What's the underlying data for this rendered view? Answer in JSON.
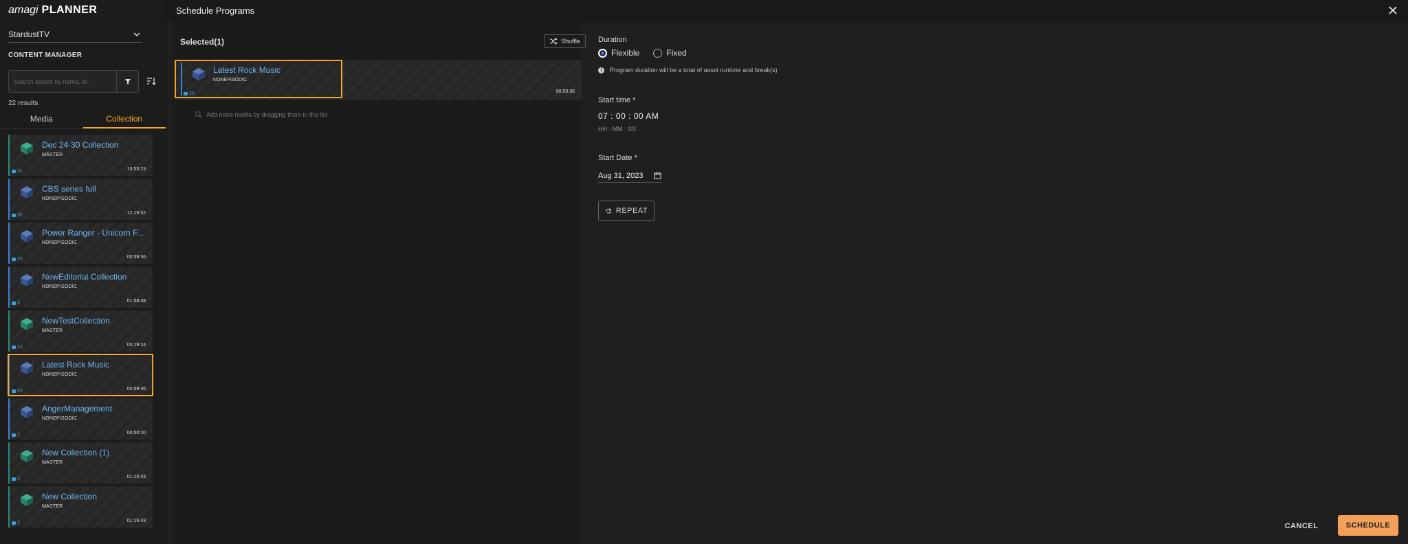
{
  "brand": {
    "logo_prefix": "amagi",
    "logo_suffix": "PLANNER"
  },
  "sidebar": {
    "channel": "StardustTV",
    "section_title": "CONTENT MANAGER",
    "search_placeholder": "Search assets by name, id...",
    "results": "22 results",
    "tabs": [
      "Media",
      "Collection"
    ],
    "active_tab": "Collection",
    "items": [
      {
        "title": "Dec 24-30 Collection",
        "type": "MASTER",
        "count": "31",
        "duration": "13:55:23"
      },
      {
        "title": "CBS series full",
        "type": "NONEPISODIC",
        "count": "30",
        "duration": "12:19:52"
      },
      {
        "title": "Power Ranger - Unicorn F...",
        "type": "NONEPISODIC",
        "count": "25",
        "duration": "00:59:36"
      },
      {
        "title": "NewEditorial Collection",
        "type": "NONEPISODIC",
        "count": "3",
        "duration": "01:58:48"
      },
      {
        "title": "NewTestCollection",
        "type": "MASTER",
        "count": "13",
        "duration": "05:19:24"
      },
      {
        "title": "Latest Rock Music",
        "type": "NONEPISODIC",
        "count": "25",
        "duration": "00:59:36"
      },
      {
        "title": "AngerManagement",
        "type": "NONEPISODIC",
        "count": "1",
        "duration": "00:50:20"
      },
      {
        "title": "New Collection (1)",
        "type": "MASTER",
        "count": "2",
        "duration": "01:15:43"
      },
      {
        "title": "New Collection",
        "type": "MASTER",
        "count": "2",
        "duration": "01:15:43"
      }
    ]
  },
  "modal": {
    "title": "Schedule Programs",
    "selected_label": "Selected(1)",
    "shuffle_label": "Shuffle",
    "selected_item": {
      "title": "Latest Rock Music",
      "type": "NONEPISODIC",
      "count": "25",
      "duration": "00:59:36"
    },
    "drag_hint": "Add more media by dragging them in the list",
    "duration_label": "Duration",
    "duration_options": [
      "Flexible",
      "Fixed"
    ],
    "duration_selected": "Flexible",
    "duration_info": "Program duration will be a total of asset runtime and break(s)",
    "start_time_label": "Start time *",
    "start_time_value": "07 : 00 : 00 AM",
    "start_time_format": "HH : MM : SS",
    "start_date_label": "Start Date *",
    "start_date_value": "Aug 31, 2023",
    "repeat_label": "REPEAT",
    "cancel_label": "CANCEL",
    "schedule_label": "SCHEDULE"
  },
  "colors": {
    "accent": "#f5a623",
    "link": "#6fb7f2",
    "schedule_button": "#f5a05a",
    "master_bar": "#2a8a7a",
    "nonepisodic_bar": "#3b7fd4"
  }
}
